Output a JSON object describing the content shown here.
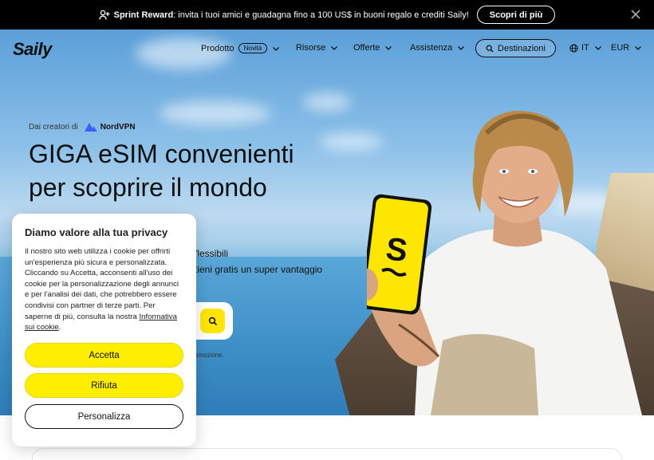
{
  "banner": {
    "bold": "Sprint Reward",
    "text": ": invita i tuoi amici e guadagna fino a 100 US$ in buoni regalo e crediti Saily!",
    "cta": "Scopri di più"
  },
  "nav": {
    "logo": "Saily",
    "items": [
      {
        "label": "Prodotto",
        "badge": "Novità"
      },
      {
        "label": "Risorse"
      },
      {
        "label": "Offerte"
      },
      {
        "label": "Assistenza"
      }
    ],
    "destinations": "Destinazioni",
    "language": "IT",
    "currency": "EUR"
  },
  "hero": {
    "creators_prefix": "Dai creatori di",
    "partner": "NordVPN",
    "headline_line1": "GIGA eSIM convenienti",
    "headline_line2": "per scoprire il mondo",
    "sub1": "flessibili",
    "sub2": "tieni gratis un super vantaggio",
    "promo": "omozione."
  },
  "cookie": {
    "title": "Diamo valore alla tua privacy",
    "body": "Il nostro sito web utilizza i cookie per offrirti un'esperienza più sicura e personalizzata. Cliccando su Accetta, acconsenti all'uso dei cookie per la personalizzazione degli annunci e per l'analisi dei dati, che potrebbero essere condivisi con partner di terze parti. Per saperne di più, consulta la nostra ",
    "link": "Informativa sui cookie",
    "after_link": ".",
    "accept": "Accetta",
    "reject": "Rifiuta",
    "customize": "Personalizza"
  },
  "colors": {
    "accent_yellow": "#ffee00",
    "banner_bg": "#000000"
  }
}
